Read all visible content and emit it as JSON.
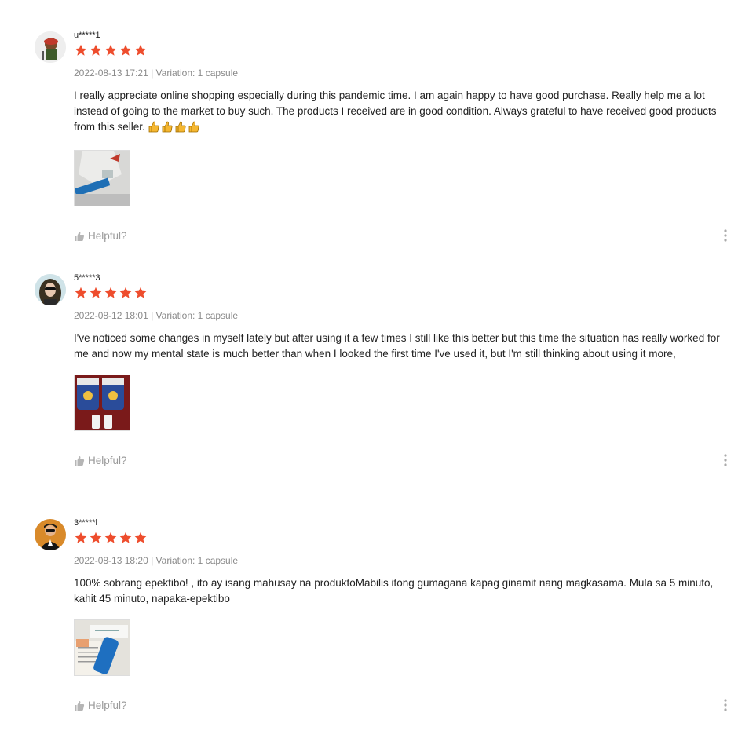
{
  "colors": {
    "star": "#ee4d2d",
    "meta_text": "#8a8a8a",
    "divider": "#e0e0e0"
  },
  "reviews": [
    {
      "username": "u*****1",
      "rating": 5,
      "date": "2022-08-13 17:21",
      "variation": "Variation: 1 capsule",
      "text": "I really appreciate online shopping especially during this pandemic time. I am again happy to have good purchase. Really help me a lot instead of going to the market to buy such. The products I received are in good condition. Always grateful to have received good products from this seller. ",
      "emoji": "thumbs-up-emoji x4",
      "helpful_label": "Helpful?"
    },
    {
      "username": "5*****3",
      "rating": 5,
      "date": "2022-08-12 18:01",
      "variation": "Variation: 1 capsule",
      "text": "I've noticed some changes in myself lately but after using it a few times I still like this better but this time the situation has really worked for me and now my mental state is much better than when I looked the first time I've used it, but I'm still thinking about using it more,",
      "helpful_label": "Helpful?"
    },
    {
      "username": "3*****l",
      "rating": 5,
      "date": "2022-08-13 18:20",
      "variation": "Variation: 1 capsule",
      "text": "100% sobrang epektibo! , ito ay isang mahusay na produktoMabilis itong gumagana kapag ginamit nang magkasama. Mula sa 5 minuto, kahit 45 minuto, napaka-epektibo",
      "helpful_label": "Helpful?"
    }
  ]
}
